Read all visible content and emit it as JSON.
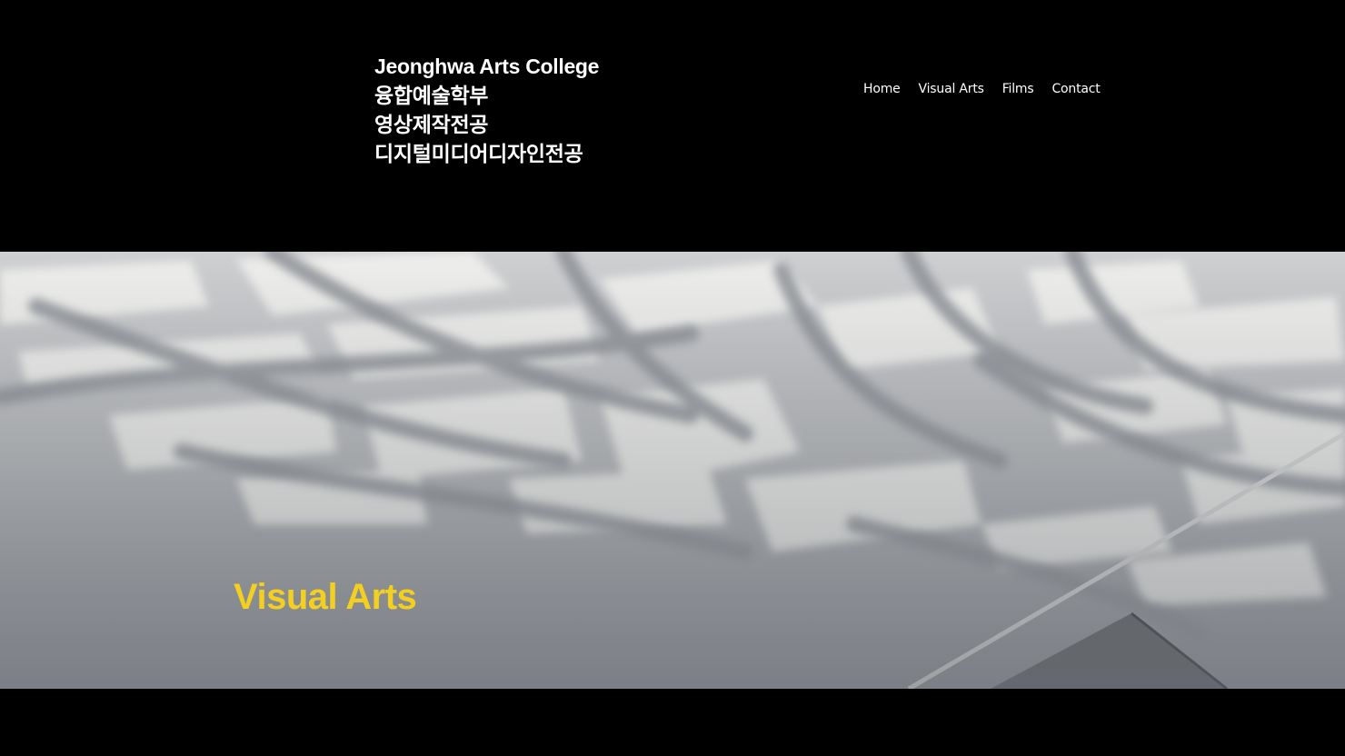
{
  "brand": {
    "lines": [
      "Jeonghwa Arts College",
      "융합예술학부",
      "영상제작전공",
      "디지털미디어디자인전공"
    ]
  },
  "nav": {
    "items": [
      "Home",
      "Visual Arts",
      "Films",
      "Contact"
    ]
  },
  "hero": {
    "title": "Visual Arts",
    "title_color": "#f2cf20",
    "image": "leaf-shadow-photo"
  }
}
